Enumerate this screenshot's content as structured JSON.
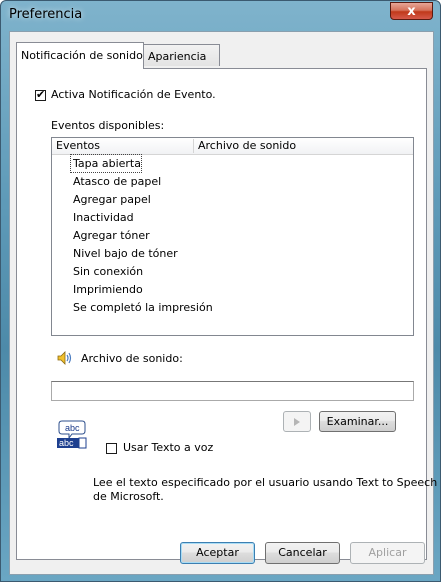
{
  "window": {
    "title": "Preferencia",
    "close_glyph": "x"
  },
  "tabs": [
    {
      "label": "Notificación de sonido",
      "active": true
    },
    {
      "label": "Apariencia",
      "active": false
    }
  ],
  "activate_checkbox": {
    "label": "Activa Notificación de Evento.",
    "checked": true
  },
  "events_label": "Eventos disponibles:",
  "events_table": {
    "columns": [
      "Eventos",
      "Archivo de sonido"
    ],
    "rows": [
      {
        "event": "Tapa abierta",
        "sound": "",
        "selected": true
      },
      {
        "event": "Atasco de papel",
        "sound": ""
      },
      {
        "event": "Agregar papel",
        "sound": ""
      },
      {
        "event": "Inactividad",
        "sound": ""
      },
      {
        "event": "Agregar tóner",
        "sound": ""
      },
      {
        "event": "Nivel bajo de tóner",
        "sound": ""
      },
      {
        "event": "Sin conexión",
        "sound": ""
      },
      {
        "event": "Imprimiendo",
        "sound": ""
      },
      {
        "event": "Se completó la impresión",
        "sound": ""
      }
    ]
  },
  "sound_file": {
    "icon": "speaker-icon",
    "label": "Archivo de sonido:",
    "value": ""
  },
  "play_button": {
    "icon": "play-icon",
    "enabled": false
  },
  "browse_button": {
    "label": "Examinar..."
  },
  "tts": {
    "icon": "abc-text-icon",
    "icon_text": "abc",
    "checkbox_label": "Usar Texto a voz",
    "checked": false,
    "description_line1": "Lee el texto especificado por el usuario usando Text to Speech",
    "description_line2": "de Microsoft."
  },
  "footer": {
    "ok_label": "Aceptar",
    "cancel_label": "Cancelar",
    "apply_label": "Aplicar",
    "apply_enabled": false
  },
  "colors": {
    "title_bar": "#5e9ab8",
    "close_button": "#c0391b",
    "dialog_bg": "#f0f0f0"
  }
}
